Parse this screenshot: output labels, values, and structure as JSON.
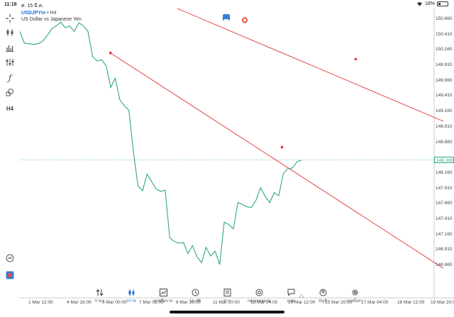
{
  "status_bar": {
    "time": "11:18",
    "date": "ศ. 15 มี.ค.",
    "battery_text": "18%",
    "battery_level": 0.18
  },
  "symbol": {
    "name": "USDJPYm",
    "separator": " • ",
    "timeframe": "H4",
    "description": "US Dollar vs Japanese Yen"
  },
  "toolbar": {
    "timeframe_label": "H4",
    "icons": [
      "crosshair-icon",
      "candlestick-icon",
      "bar-chart-icon",
      "indicators-icon",
      "function-icon",
      "shapes-icon",
      "timeframe-icon",
      "history-clock-icon",
      "app-logo-icon"
    ]
  },
  "chart_data": {
    "type": "line",
    "price_labels": [
      "150.660",
      "150.410",
      "150.160",
      "149.910",
      "149.660",
      "149.410",
      "149.160",
      "148.910",
      "148.660",
      "148.160",
      "147.910",
      "147.660",
      "147.410",
      "147.160",
      "146.910",
      "146.660"
    ],
    "current_price": "148.369",
    "time_labels": [
      "1 Mar 12:00",
      "4 Mar 16:00",
      "6 Mar 00:00",
      "7 Mar 08:00",
      "8 Mar 16:00",
      "11 Mar 20:00",
      "13 Mar 04:00",
      "14 Mar 12:00",
      "15 Mar 20:00",
      "17 Mar 04:00",
      "18 Mar 12:00",
      "19 Mar 20:00"
    ],
    "ylim": [
      146.5,
      150.8
    ],
    "series": [
      {
        "values": [
          150.46,
          150.27,
          150.26,
          150.25,
          150.26,
          150.3,
          150.39,
          150.5,
          150.55,
          150.61,
          150.52,
          150.55,
          150.46,
          150.6,
          150.55,
          150.46,
          150.05,
          149.98,
          150.0,
          149.9,
          149.55,
          149.7,
          149.35,
          149.25,
          149.18,
          148.5,
          147.95,
          147.87,
          148.14,
          148.02,
          147.9,
          147.86,
          147.88,
          147.1,
          147.05,
          147.02,
          147.03,
          146.85,
          146.98,
          146.8,
          146.7,
          146.95,
          146.81,
          146.89,
          146.67,
          147.36,
          147.32,
          147.25,
          147.68,
          147.65,
          147.61,
          147.6,
          147.72,
          147.92,
          147.78,
          147.68,
          147.84,
          147.79,
          148.15,
          148.23,
          148.24,
          148.34,
          148.37
        ]
      }
    ],
    "trendlines": [
      {
        "from": {
          "time": "5 Mar 20:00",
          "price": 150.11
        },
        "to": {
          "time": "19 Mar 20:00",
          "price": 146.61
        },
        "color": "#e03030"
      },
      {
        "from": {
          "time": "8 Mar 04:00",
          "price": 150.85
        },
        "to": {
          "time": "19 Mar 20:00",
          "price": 149.0
        },
        "color": "#e03030"
      }
    ],
    "trendline_points": [
      {
        "time": "5 Mar 20:00",
        "price": 150.11
      },
      {
        "time": "13 Mar 20:00",
        "price": 148.58
      },
      {
        "time": "16 Mar 12:00",
        "price": 150.01
      }
    ],
    "line_color": "#2ea58a",
    "current_price_line_style": "dashed",
    "grid": false
  },
  "bottom_nav": {
    "items": [
      {
        "icon": "quotes-icon",
        "label": "ราคา"
      },
      {
        "icon": "chart-icon",
        "label": "กราฟ",
        "active": true
      },
      {
        "icon": "trade-icon",
        "label": "การซื้อขาย"
      },
      {
        "icon": "history-icon",
        "label": "ประวัติ"
      },
      {
        "icon": "news-icon",
        "label": "ข่าว"
      },
      {
        "icon": "mailbox-icon",
        "label": "กล่องจดหมาย"
      },
      {
        "icon": "chat-icon",
        "label": "แชท"
      },
      {
        "icon": "account-icon",
        "label": "บัญชี"
      },
      {
        "icon": "settings-icon",
        "label": "การตั้งค่า"
      }
    ]
  },
  "colors": {
    "accent": "#1f6fd1",
    "price_line": "#2ea58a",
    "trendline": "#e03030"
  }
}
